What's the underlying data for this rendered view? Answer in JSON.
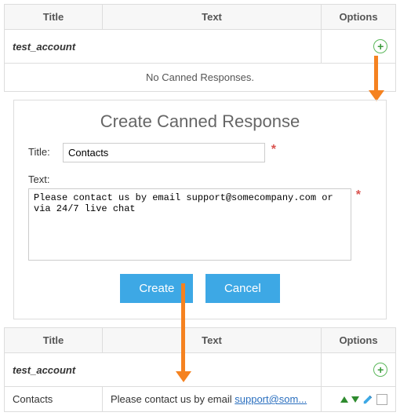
{
  "table_headers": {
    "title": "Title",
    "text": "Text",
    "options": "Options"
  },
  "account_name": "test_account",
  "empty_msg": "No Canned Responses.",
  "panel": {
    "heading": "Create Canned Response",
    "title_label": "Title:",
    "text_label": "Text:",
    "title_value": "Contacts",
    "text_value": "Please contact us by email support@somecompany.com or via 24/7 live chat",
    "create_btn": "Create",
    "cancel_btn": "Cancel"
  },
  "result_row": {
    "title": "Contacts",
    "text_prefix": "Please contact us by email ",
    "text_link": "support@som..."
  }
}
